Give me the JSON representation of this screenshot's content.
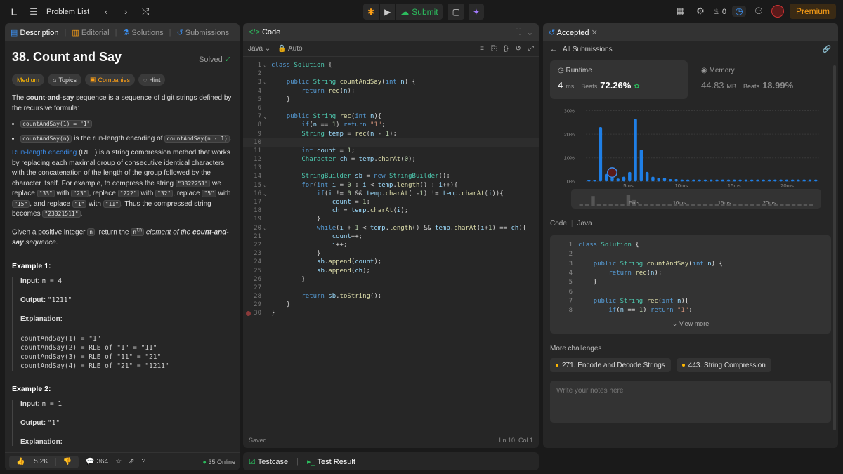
{
  "topbar": {
    "logo": "L",
    "problem_list": "Problem List",
    "submit": "Submit",
    "streak": "0",
    "premium": "Premium"
  },
  "left": {
    "tabs": [
      "Description",
      "Editorial",
      "Solutions",
      "Submissions"
    ],
    "title": "38. Count and Say",
    "solved": "Solved",
    "tags": [
      "Medium",
      "Topics",
      "Companies",
      "Hint"
    ],
    "intro_a": "The ",
    "intro_b": "count-and-say",
    "intro_c": " sequence is a sequence of digit strings defined by the recursive formula:",
    "bullet1_code": "countAndSay(1) = \"1\"",
    "bullet2_code": "countAndSay(n)",
    "bullet2_text": " is the run-length encoding of ",
    "bullet2_code2": "countAndSay(n - 1)",
    "bullet2_end": ".",
    "rle_link": "Run-length encoding",
    "rle_a": " (RLE) is a string compression method that works by replacing each maximal group of consecutive identical characters with the concatenation of the length of the group followed by the character itself. For example, to compress the string ",
    "rle_c1": "\"3322251\"",
    "rle_b": " we replace ",
    "rle_c2": "\"33\"",
    "rle_w1": " with ",
    "rle_c3": "\"23\"",
    "rle_r2": ", replace ",
    "rle_c4": "\"222\"",
    "rle_w2": " with ",
    "rle_c5": "\"32\"",
    "rle_r3": ", replace ",
    "rle_c6": "\"5\"",
    "rle_w3": " with ",
    "rle_c7": "\"15\"",
    "rle_r4": ", and replace ",
    "rle_c8": "\"1\"",
    "rle_w4": " with ",
    "rle_c9": "\"11\"",
    "rle_end": ". Thus the compressed string becomes ",
    "rle_c10": "\"23321511\"",
    "rle_dot": ".",
    "given_a": "Given a positive integer ",
    "given_n": "n",
    "given_b": ", return the ",
    "given_nth": "n",
    "given_th": "th",
    "given_c": " element of the ",
    "given_d": "count-and-say",
    "given_e": " sequence.",
    "ex1_title": "Example 1:",
    "ex1_input_lbl": "Input:",
    "ex1_input": "n = 4",
    "ex1_output_lbl": "Output:",
    "ex1_output": "\"1211\"",
    "ex1_expl_lbl": "Explanation:",
    "ex1_expl": "countAndSay(1) = \"1\"\ncountAndSay(2) = RLE of \"1\" = \"11\"\ncountAndSay(3) = RLE of \"11\" = \"21\"\ncountAndSay(4) = RLE of \"21\" = \"1211\"",
    "ex2_title": "Example 2:",
    "ex2_input_lbl": "Input:",
    "ex2_input": "n = 1",
    "ex2_output_lbl": "Output:",
    "ex2_output": "\"1\"",
    "ex2_expl_lbl": "Explanation:",
    "likes": "5.2K",
    "comments": "364",
    "online": "35 Online"
  },
  "mid": {
    "title": "Code",
    "lang": "Java",
    "auto": "Auto",
    "saved": "Saved",
    "cursor": "Ln 10, Col 1",
    "code": [
      "class Solution {",
      "",
      "    public String countAndSay(int n) {",
      "        return rec(n);",
      "    }",
      "",
      "    public String rec(int n){",
      "        if(n == 1) return \"1\";",
      "        String temp = rec(n - 1);",
      "",
      "        int count = 1;",
      "        Character ch = temp.charAt(0);",
      "",
      "        StringBuilder sb = new StringBuilder();",
      "        for(int i = 0 ; i < temp.length() ; i++){",
      "            if(i != 0 && temp.charAt(i-1) != temp.charAt(i)){",
      "                count = 1;",
      "                ch = temp.charAt(i);",
      "            }",
      "            while(i + 1 < temp.length() && temp.charAt(i+1) == ch){",
      "                count++;",
      "                i++;",
      "            }",
      "            sb.append(count);",
      "            sb.append(ch);",
      "        }",
      "",
      "        return sb.toString();",
      "    }",
      "}"
    ],
    "folds": [
      1,
      3,
      7,
      15,
      16,
      20
    ]
  },
  "bottom": {
    "testcase": "Testcase",
    "result": "Test Result"
  },
  "right": {
    "tab": "Accepted",
    "all_submissions": "All Submissions",
    "runtime_label": "Runtime",
    "runtime_value": "4",
    "runtime_unit": "ms",
    "runtime_beats_lbl": "Beats",
    "runtime_beats": "72.26%",
    "memory_label": "Memory",
    "memory_value": "44.83",
    "memory_unit": "MB",
    "memory_beats_lbl": "Beats",
    "memory_beats": "18.99%",
    "code_label": "Code",
    "code_lang": "Java",
    "snippet": [
      "class Solution {",
      "",
      "    public String countAndSay(int n) {",
      "        return rec(n);",
      "    }",
      "",
      "    public String rec(int n){",
      "        if(n == 1) return \"1\";"
    ],
    "view_more": "View more",
    "more_challenges": "More challenges",
    "challenges": [
      "271. Encode and Decode Strings",
      "443. String Compression"
    ],
    "notes_placeholder": "Write your notes here",
    "colors": {
      "accent": "#ffa116",
      "green": "#2cbb5d",
      "bar": "#1f7fe6"
    }
  },
  "chart_data": {
    "type": "bar",
    "title": "",
    "xlabel": "",
    "ylabel": "",
    "y_tick_labels": [
      "0%",
      "10%",
      "20%",
      "30%"
    ],
    "x_tick_labels": [
      "5ms",
      "10ms",
      "15ms",
      "20ms"
    ],
    "ylim": [
      0,
      30
    ],
    "x": [
      0,
      1,
      2,
      3,
      4,
      5,
      6,
      7,
      8,
      9,
      10,
      11,
      12,
      13,
      14,
      15,
      16,
      17,
      18,
      19,
      20,
      21,
      22,
      23,
      24,
      25,
      26,
      27,
      28,
      29,
      30,
      31,
      32,
      33,
      34,
      35,
      36,
      37,
      38,
      39
    ],
    "values": [
      0.5,
      0.5,
      23,
      3.2,
      1.5,
      1.2,
      2,
      4,
      26.5,
      13.5,
      4,
      2,
      1.5,
      1.5,
      1,
      1,
      0.8,
      0.8,
      0.8,
      0.8,
      0.8,
      0.8,
      0.8,
      0.8,
      0.8,
      0.8,
      0.8,
      0.8,
      0.8,
      0.8,
      0.8,
      0.8,
      0.8,
      0.8,
      0.8,
      0.8,
      0.8,
      0.8,
      0.8,
      0.8
    ],
    "highlight_x": 4
  }
}
